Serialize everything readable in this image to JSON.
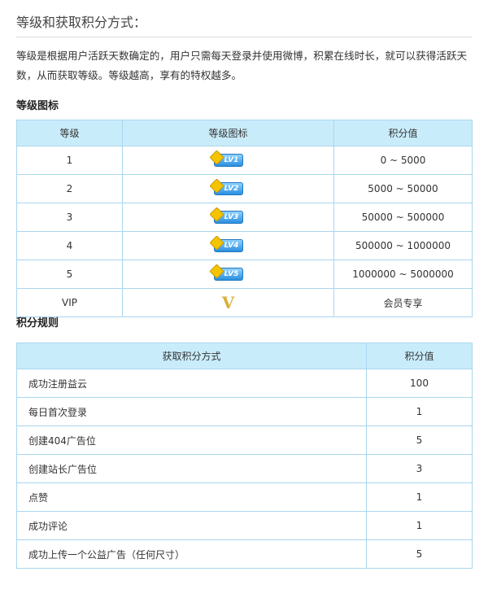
{
  "title": "等级和获取积分方式：",
  "intro": "等级是根据用户活跃天数确定的，用户只需每天登录并使用微博，积累在线时长，就可以获得活跃天数，从而获取等级。等级越高，享有的特权越多。",
  "level_section": {
    "heading": "等级图标",
    "columns": [
      "等级",
      "等级图标",
      "积分值"
    ],
    "rows": [
      {
        "level": "1",
        "icon_label": "LV1",
        "range": "0 ~ 5000"
      },
      {
        "level": "2",
        "icon_label": "LV2",
        "range": "5000 ~ 50000"
      },
      {
        "level": "3",
        "icon_label": "LV3",
        "range": "50000 ~ 500000"
      },
      {
        "level": "4",
        "icon_label": "LV4",
        "range": "500000 ~ 1000000"
      },
      {
        "level": "5",
        "icon_label": "LV5",
        "range": "1000000 ~ 5000000"
      },
      {
        "level": "VIP",
        "icon_label": "V",
        "range": "会员专享"
      }
    ]
  },
  "points_section": {
    "heading": "积分规则",
    "columns": [
      "获取积分方式",
      "积分值"
    ],
    "rows": [
      {
        "method": "成功注册益云",
        "points": "100"
      },
      {
        "method": "每日首次登录",
        "points": "1"
      },
      {
        "method": "创建404广告位",
        "points": "5"
      },
      {
        "method": "创建站长广告位",
        "points": "3"
      },
      {
        "method": "点赞",
        "points": "1"
      },
      {
        "method": "成功评论",
        "points": "1"
      },
      {
        "method": "成功上传一个公益广告（任何尺寸）",
        "points": "5"
      }
    ]
  }
}
